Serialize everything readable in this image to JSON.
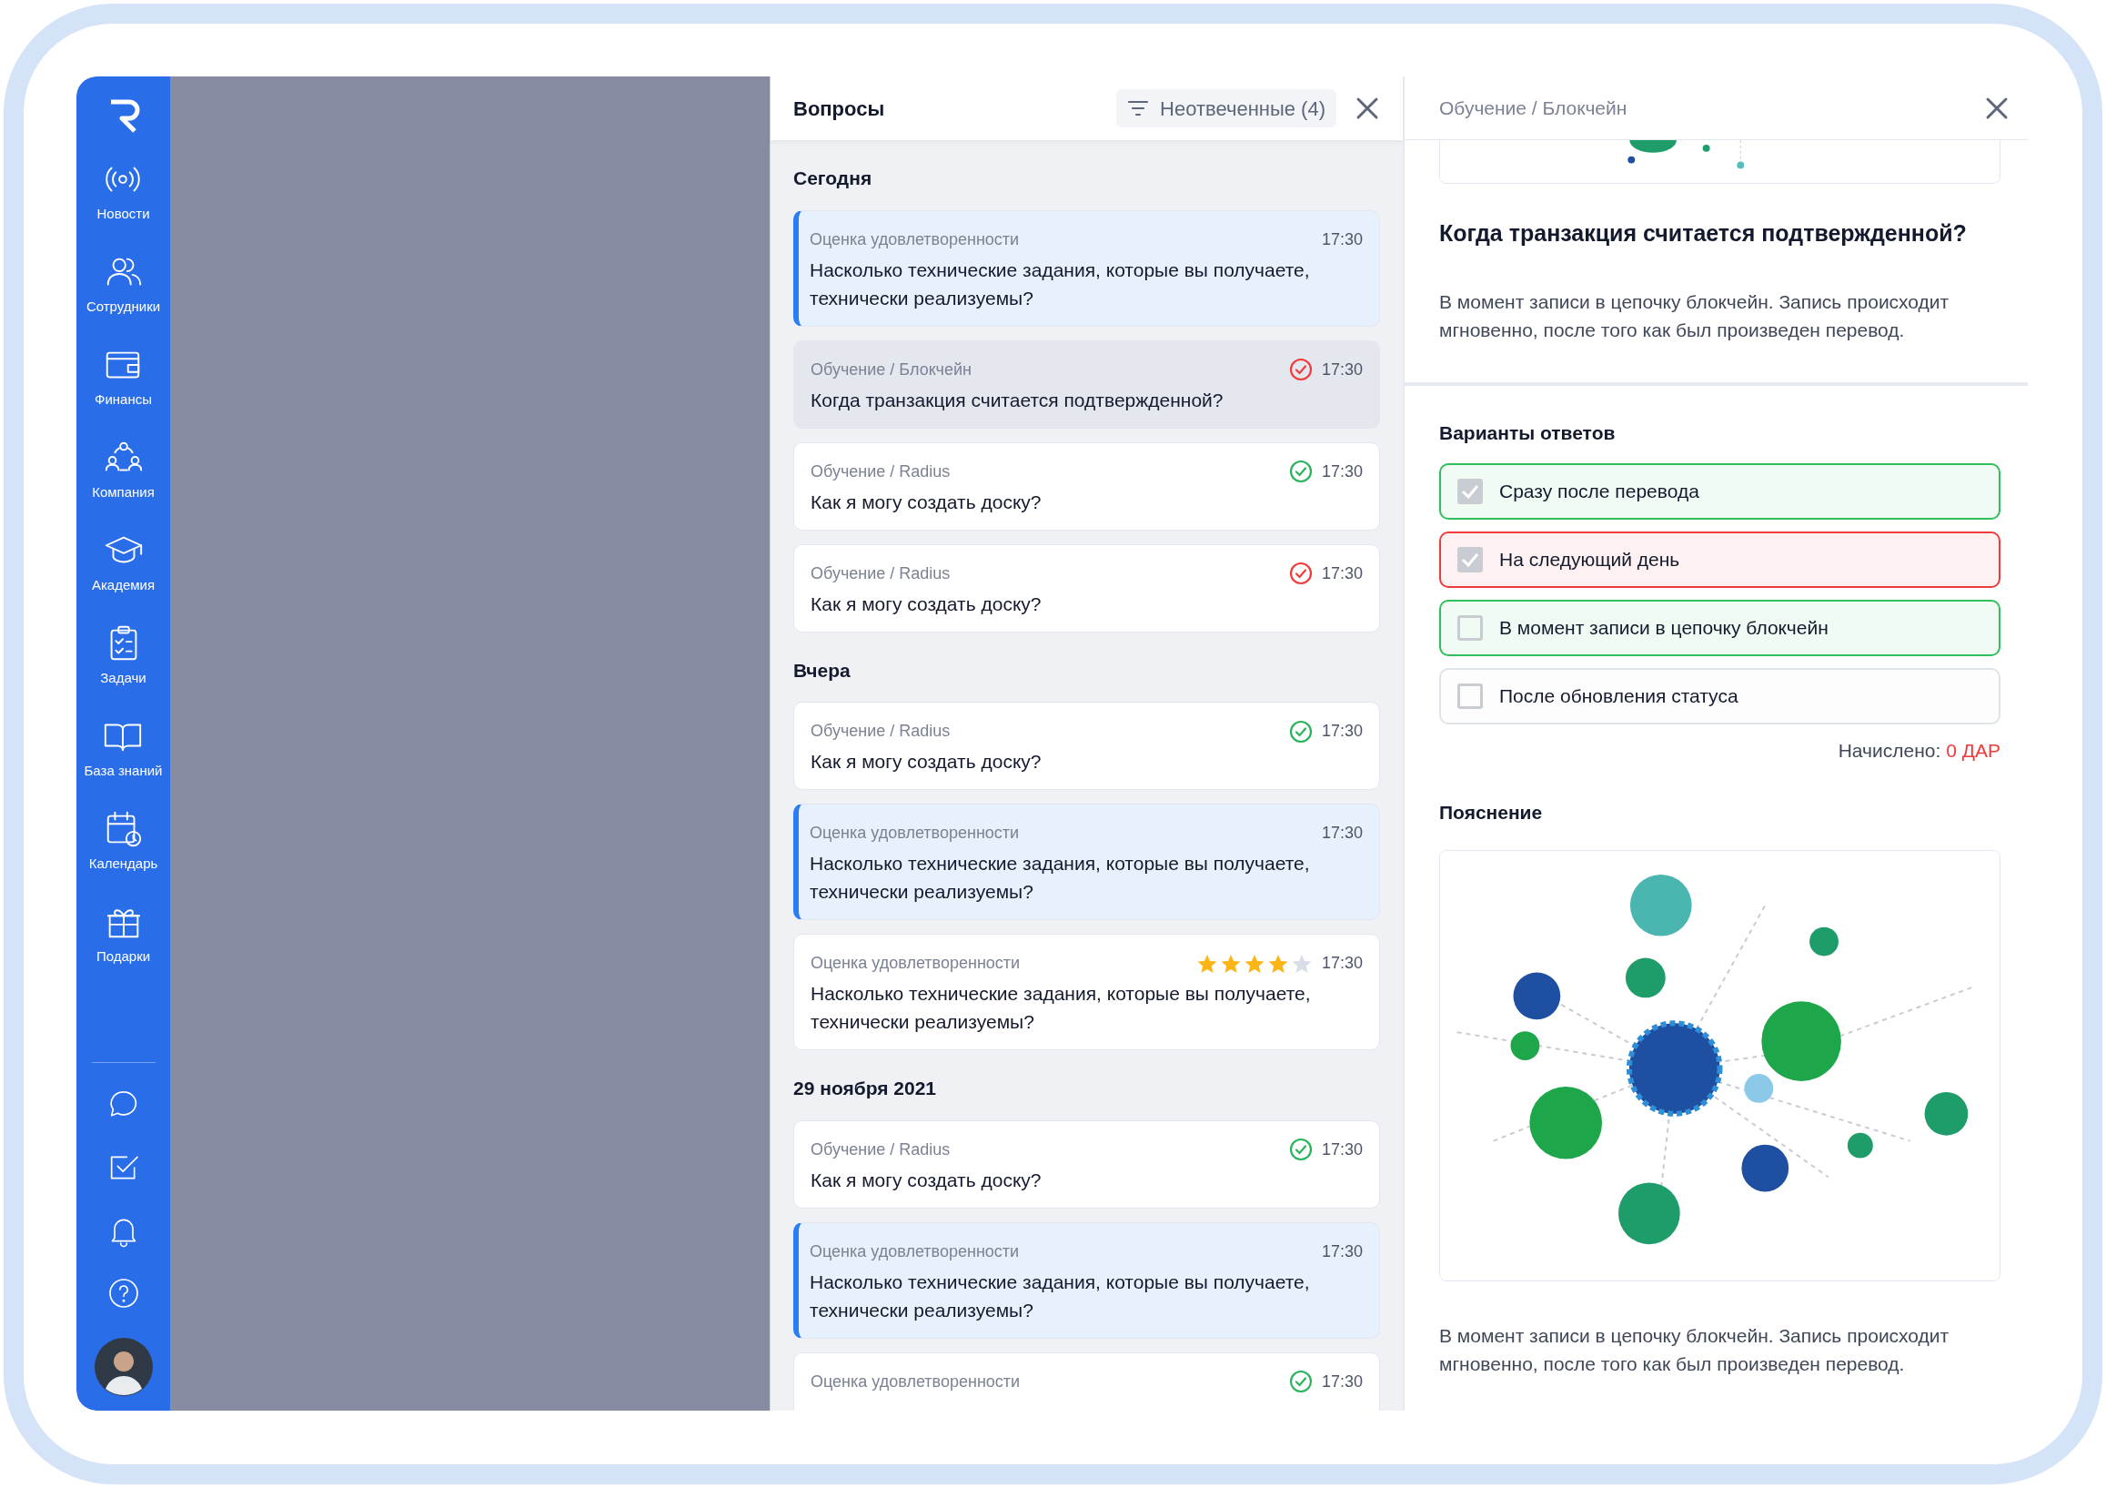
{
  "sidebar": {
    "items": [
      {
        "label": "Новости"
      },
      {
        "label": "Сотрудники"
      },
      {
        "label": "Финансы"
      },
      {
        "label": "Компания"
      },
      {
        "label": "Академия"
      },
      {
        "label": "Задачи"
      },
      {
        "label": "База знаний"
      },
      {
        "label": "Календарь"
      },
      {
        "label": "Подарки"
      }
    ]
  },
  "questions": {
    "title": "Вопросы",
    "filter": "Неотвеченные (4)",
    "groups": [
      {
        "title": "Сегодня",
        "items": [
          {
            "category": "Оценка удовлетворенности",
            "time": "17:30",
            "question": "Насколько технические задания, которые вы получаете, технически реализуемы?",
            "unread": true,
            "selected": false
          },
          {
            "category": "Обучение / Блокчейн",
            "time": "17:30",
            "question": "Когда транзакция считается подтвержденной?",
            "color": "#ef3b3b",
            "unread": false,
            "selected": true
          },
          {
            "category": "Обучение / Radius",
            "time": "17:30",
            "question": "Как я могу создать доску?",
            "color": "#27b35a",
            "unread": false,
            "selected": false
          },
          {
            "category": "Обучение / Radius",
            "time": "17:30",
            "question": "Как я могу создать доску?",
            "color": "#ef3b3b",
            "unread": false,
            "selected": false
          }
        ]
      },
      {
        "title": "Вчера",
        "items": [
          {
            "category": "Обучение / Radius",
            "time": "17:30",
            "question": "Как я могу создать доску?",
            "color": "#27b35a",
            "unread": false,
            "selected": false
          },
          {
            "category": "Оценка удовлетворенности",
            "time": "17:30",
            "question": "Насколько технические задания, которые вы получаете, технически реализуемы?",
            "unread": true,
            "selected": false
          },
          {
            "category": "Оценка удовлетворенности",
            "time": "17:30",
            "question": "Насколько технические задания, которые вы получаете, технически реализуемы?",
            "stars": 4,
            "unread": false,
            "selected": false
          }
        ]
      },
      {
        "title": "29 ноября 2021",
        "items": [
          {
            "category": "Обучение / Radius",
            "time": "17:30",
            "question": "Как я могу создать доску?",
            "color": "#27b35a",
            "unread": false,
            "selected": false
          },
          {
            "category": "Оценка удовлетворенности",
            "time": "17:30",
            "question": "Насколько технические задания, которые вы получаете, технически реализуемы?",
            "unread": true,
            "selected": false
          },
          {
            "category": "Оценка удовлетворенности",
            "time": "17:30",
            "color": "#27b35a",
            "unread": false,
            "selected": false
          }
        ]
      }
    ]
  },
  "detail": {
    "breadcrumb": "Обучение / Блокчейн",
    "question": "Когда транзакция считается подтвержденной?",
    "answer": "В момент записи в цепочку блокчейн. Запись происходит мгновенно, после того как был произведен перевод.",
    "options_title": "Варианты ответов",
    "options": [
      {
        "label": "Сразу после перевода",
        "checked": true,
        "color": "#2fbf5b"
      },
      {
        "label": "На следующий день",
        "checked": true,
        "color": "#ef3b3b"
      },
      {
        "label": "В момент записи в цепочку блокчейн",
        "checked": false,
        "color": "#2fbf5b"
      },
      {
        "label": "После обновления статуса",
        "checked": false,
        "color": "#dfe3ea"
      }
    ],
    "reward_label": "Начислено:",
    "reward_value": "0 ДАР",
    "explanation_title": "Пояснение",
    "explanation": "В момент записи в цепочку блокчейн. Запись происходит мгновенно, после того как был произведен перевод."
  }
}
